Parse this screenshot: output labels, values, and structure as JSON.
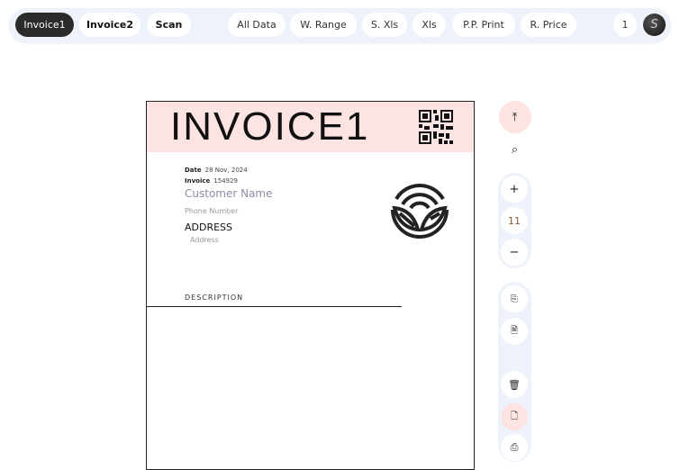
{
  "nav": {
    "tabs": [
      "Invoice1",
      "Invoice2",
      "Scan"
    ],
    "actions": [
      "All Data",
      "W. Range",
      "S. Xls",
      "Xls",
      "P.P. Print",
      "R. Price"
    ],
    "page_count": "1",
    "avatar_icon": "signature-avatar"
  },
  "invoice": {
    "title": "INVOICE1",
    "date_label": "Date",
    "date_value": "28 Nov, 2024",
    "invoice_label": "Invoice",
    "invoice_value": "154929",
    "customer_name": "Customer Name",
    "phone": "Phone Number",
    "address_label": "ADDRESS",
    "address": "Address",
    "description_label": "DESCRIPTION",
    "header_color": "#fde3e1"
  },
  "toolbar": {
    "zoom_level": "11",
    "plus": "+",
    "minus": "−",
    "icons": [
      "upload-icon",
      "search-icon",
      "zoom-in-icon",
      "zoom-out-icon",
      "file-code-icon",
      "file-code-icon",
      "trash-icon",
      "file-add-icon",
      "print-icon"
    ]
  }
}
